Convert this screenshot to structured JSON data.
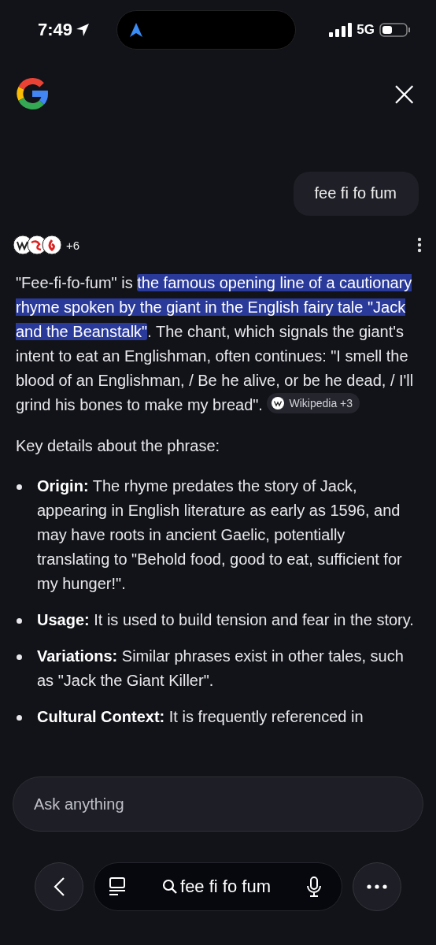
{
  "status_bar": {
    "time": "7:49",
    "network": "5G"
  },
  "header": {
    "close_label": "×"
  },
  "query_bubble": {
    "text": "fee fi fo fum"
  },
  "sources": {
    "count": "+6"
  },
  "answer": {
    "intro": [
      {
        "text": "\"Fee-fi-fo-fum\" is ",
        "highlighted": false
      },
      {
        "text": "the famous opening line of a cautionary rhyme spoken by the giant in the English fairy tale \"Jack and the Beanstalk\"",
        "highlighted": true
      },
      {
        "text": ". The chant, which signals the giant's intent to eat an Englishman, often continues: \"I smell the blood of an Englishman, / Be he alive, or be he dead, / I'll grind his bones to make my bread\". ",
        "highlighted": false
      }
    ],
    "citation": {
      "label": "Wikipedia +3"
    },
    "lead": "Key details about the phrase:",
    "bullets": [
      {
        "text": "**Origin:** The rhyme predates the story of Jack, appearing in English literature as early as 1596, and may have roots in ancient Gaelic, potentially translating to \"Behold food, good to eat, sufficient for my hunger!\"."
      },
      {
        "text": "**Usage:** It is used to build tension and fear in the story."
      },
      {
        "text": "**Variations:** Similar phrases exist in other tales, such as \"Jack the Giant Killer\"."
      },
      {
        "text": "**Cultural Context:** It is frequently referenced in"
      }
    ]
  },
  "ask_field": {
    "placeholder": "Ask anything"
  },
  "bottom_bar": {
    "query": "fee fi fo fum"
  }
}
